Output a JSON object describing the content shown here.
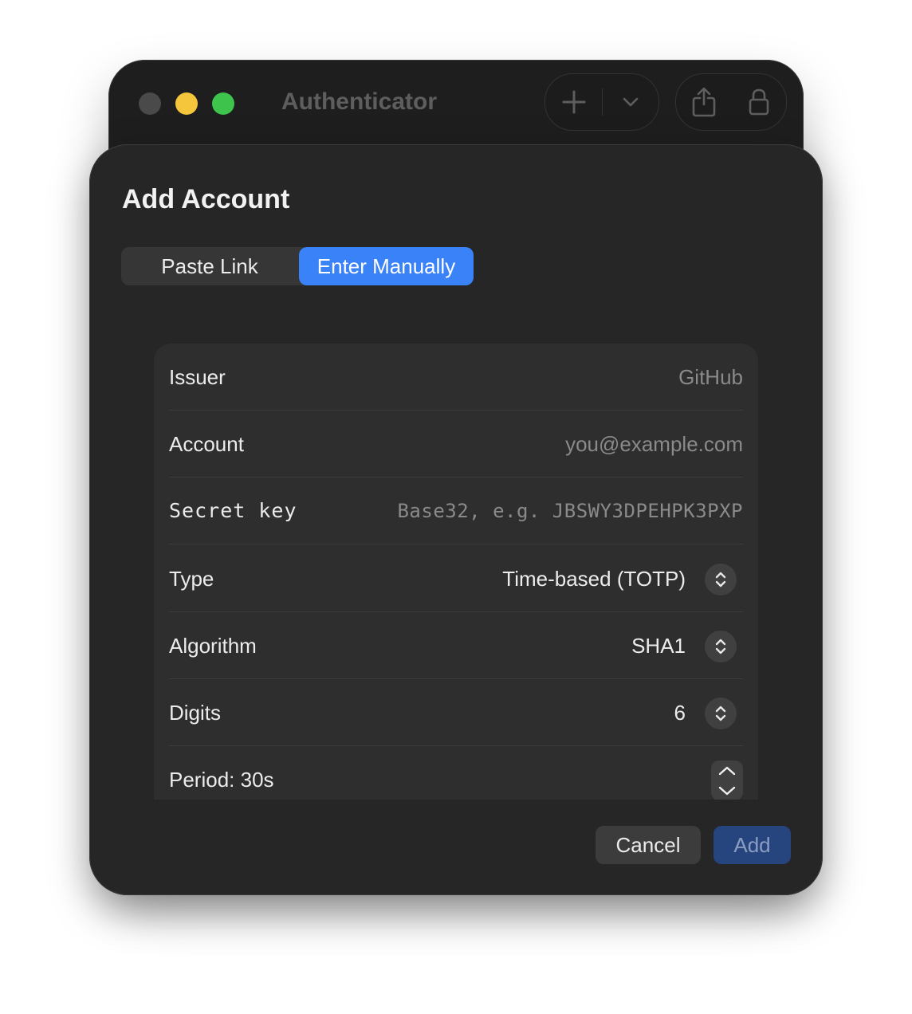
{
  "window": {
    "title": "Authenticator",
    "toolbar": {
      "add_icon": "plus-icon",
      "menu_icon": "chevron-down-icon",
      "share_icon": "share-icon",
      "lock_icon": "lock-icon"
    }
  },
  "sheet": {
    "title": "Add Account",
    "tabs": [
      {
        "label": "Paste Link",
        "selected": false
      },
      {
        "label": "Enter Manually",
        "selected": true
      }
    ],
    "fields": {
      "issuer": {
        "label": "Issuer",
        "placeholder": "GitHub",
        "value": ""
      },
      "account": {
        "label": "Account",
        "placeholder": "you@example.com",
        "value": ""
      },
      "secret": {
        "label": "Secret key",
        "placeholder": "Base32, e.g. JBSWY3DPEHPK3PXP",
        "value": ""
      },
      "type": {
        "label": "Type",
        "value": "Time-based (TOTP)"
      },
      "algorithm": {
        "label": "Algorithm",
        "value": "SHA1"
      },
      "digits": {
        "label": "Digits",
        "value": "6"
      },
      "period": {
        "label": "Period: 30s"
      }
    },
    "buttons": {
      "cancel": "Cancel",
      "add": "Add"
    }
  },
  "colors": {
    "accent": "#3a82f7",
    "add_button_disabled": "#26447e",
    "traffic_minimize": "#f5c63b",
    "traffic_maximize": "#3ec44d"
  }
}
